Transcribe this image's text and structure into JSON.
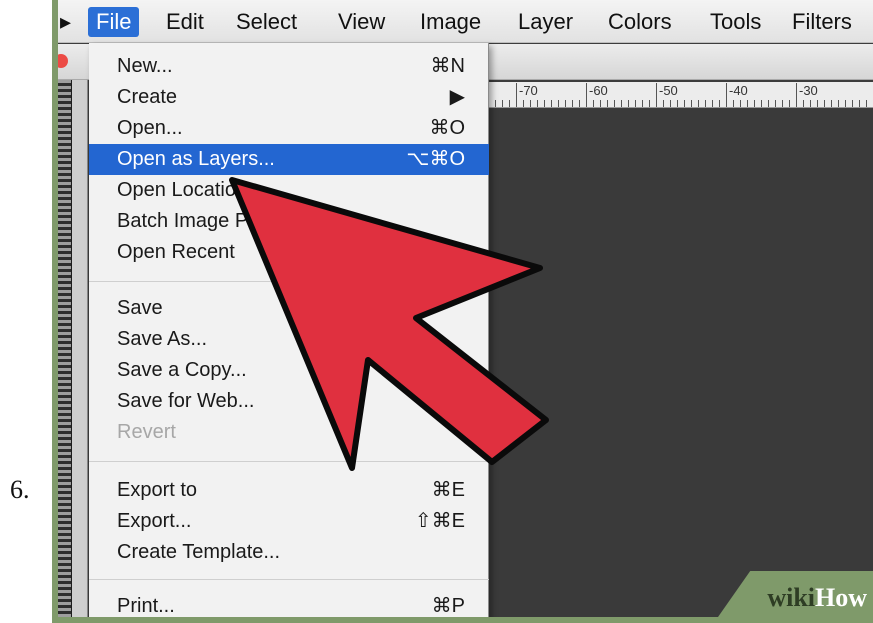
{
  "step": {
    "number": "6."
  },
  "menubar": {
    "items": [
      {
        "label": "▸"
      },
      {
        "label": "File",
        "active": true
      },
      {
        "label": "Edit"
      },
      {
        "label": "Select"
      },
      {
        "label": "View"
      },
      {
        "label": "Image"
      },
      {
        "label": "Layer"
      },
      {
        "label": "Colors"
      },
      {
        "label": "Tools"
      },
      {
        "label": "Filters"
      }
    ]
  },
  "file_menu": {
    "items": [
      {
        "label": "New...",
        "shortcut": "⌘N"
      },
      {
        "label": "Create",
        "shortcut": "▶"
      },
      {
        "label": "Open...",
        "shortcut": "⌘O"
      },
      {
        "label": "Open as Layers...",
        "shortcut": "⌥⌘O",
        "selected": true
      },
      {
        "label": "Open Location...",
        "shortcut": ""
      },
      {
        "label": "Batch Image Processing...",
        "shortcut": ""
      },
      {
        "label": "Open Recent",
        "shortcut": ""
      },
      {
        "label": "Save",
        "shortcut": ""
      },
      {
        "label": "Save As...",
        "shortcut": ""
      },
      {
        "label": "Save a Copy...",
        "shortcut": ""
      },
      {
        "label": "Save for Web...",
        "shortcut": ""
      },
      {
        "label": "Revert",
        "shortcut": "",
        "disabled": true
      },
      {
        "label": "Export to",
        "shortcut": "⌘E"
      },
      {
        "label": "Export...",
        "shortcut": "⇧⌘E"
      },
      {
        "label": "Create Template...",
        "shortcut": ""
      },
      {
        "label": "Print...",
        "shortcut": "⌘P"
      }
    ]
  },
  "ruler": {
    "labels": [
      "-70",
      "-60",
      "-50",
      "-40",
      "-30"
    ]
  },
  "colors": {
    "selection": "#2366d1",
    "arrow_fill": "#e0303f",
    "frame": "#7f9a6a"
  },
  "watermark": {
    "wiki": "wiki",
    "how": "How"
  }
}
